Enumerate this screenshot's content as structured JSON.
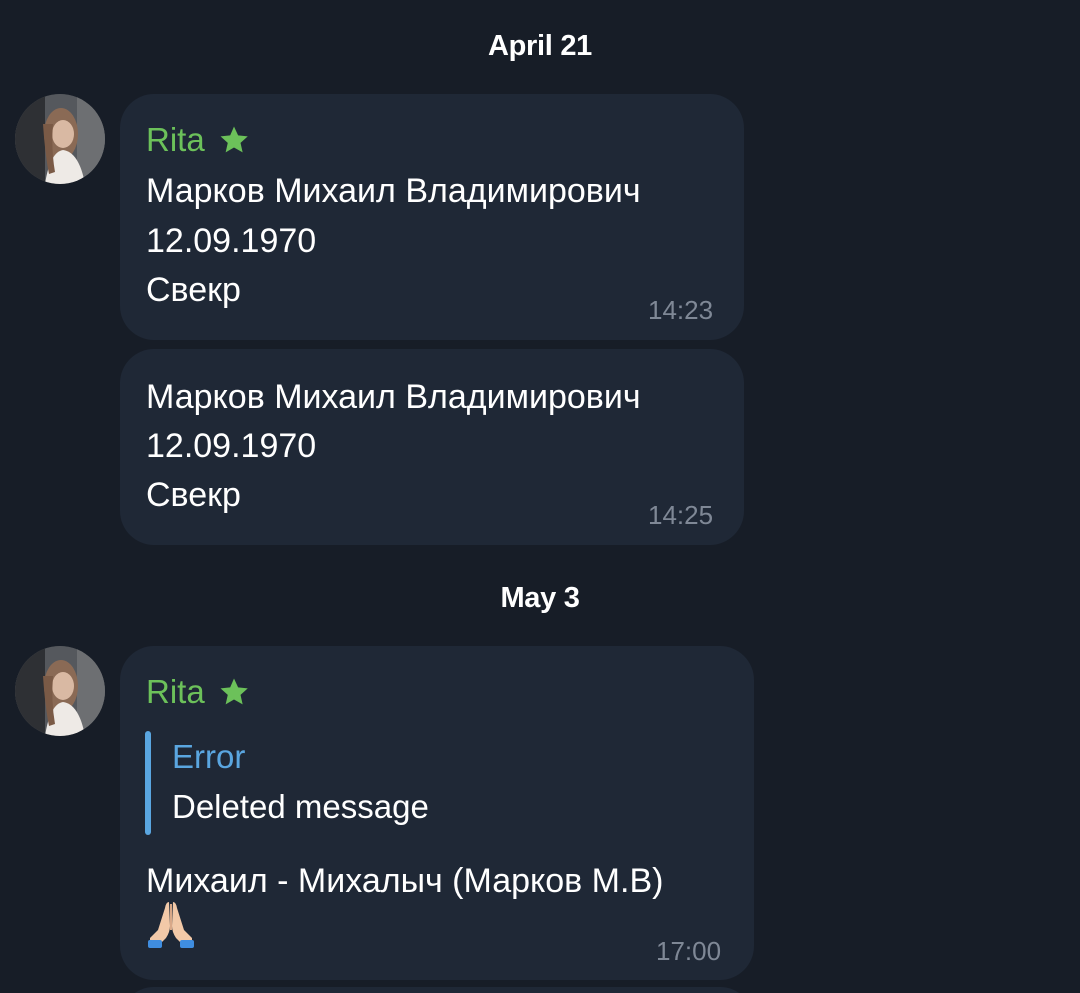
{
  "dates": [
    "April 21",
    "May 3"
  ],
  "messages": [
    {
      "sender": "Rita",
      "lines": [
        "Марков Михаил Владимирович",
        "12.09.1970",
        "Свекр"
      ],
      "time": "14:23"
    },
    {
      "lines": [
        "Марков Михаил Владимирович",
        "12.09.1970",
        "Свекр"
      ],
      "time": "14:25"
    },
    {
      "sender": "Rita",
      "reply": {
        "title": "Error",
        "text": "Deleted message"
      },
      "lines": [
        "Михаил - Михалыч (Марков М.В)"
      ],
      "emoji": "folded-hands-emoji",
      "time": "17:00"
    }
  ],
  "colors": {
    "background": "#171d27",
    "bubble": "#1f2836",
    "sender_name": "#6cc15a",
    "reply_accent": "#5aa6e0",
    "timestamp": "#7f8896"
  },
  "icons": {
    "sender_badge": "star-icon",
    "avatar": "avatar"
  }
}
